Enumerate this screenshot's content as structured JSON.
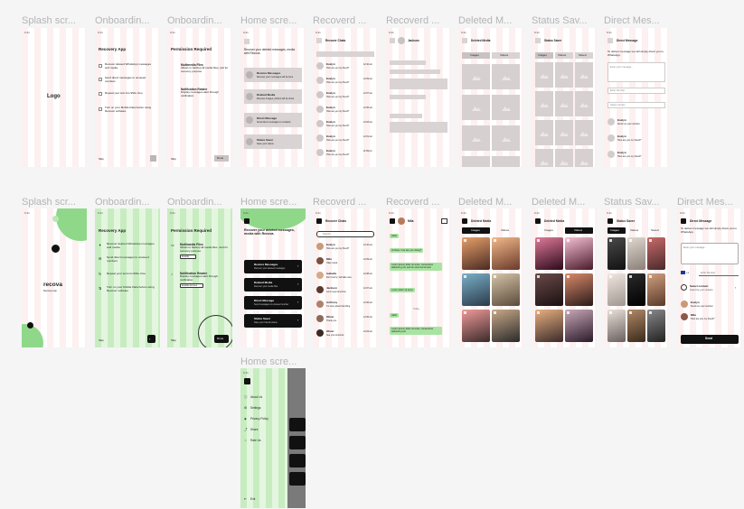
{
  "labels_row1": [
    "Splash scr...",
    "Onboardin...",
    "Onboardin...",
    "Home scre...",
    "Recoverd ...",
    "Recoverd ...",
    "Deleted M...",
    "Status Sav...",
    "Direct Mes..."
  ],
  "labels_row2": [
    "Splash scr...",
    "Onboardin...",
    "Onboardin...",
    "Home scre...",
    "Recoverd ...",
    "Recoverd ...",
    "Deleted M...",
    "Deleted M...",
    "Status Sav...",
    "Direct Mes..."
  ],
  "label_row3": "Home scre...",
  "status_bar": "9:41",
  "wf": {
    "logo": "Logo",
    "onb1_title": "Recovery App",
    "onb1_items": [
      "Recover deleted WhatsApp messages and media",
      "Send direct messages to unsaved numbers",
      "Repeat your text into 999+ time",
      "Turn on your Mobile Data before using Recover software"
    ],
    "skip": "Skip",
    "onb2_title": "Permission Required",
    "onb2_items": [
      {
        "title": "Multimedia Files",
        "desc": "Allows to backup all media files, just for recovery purpose"
      },
      {
        "title": "Notification Reader",
        "desc": "Display messages alert through notification"
      }
    ],
    "done": "Done",
    "home_intro": "Recover your deleted messages, media with Recova.",
    "home_items": [
      {
        "title": "Restore Messages",
        "desc": "Recover your messages will be here"
      },
      {
        "title": "Deleted Media",
        "desc": "Recover images, photos will be show"
      },
      {
        "title": "Direct Message",
        "desc": "Send direct messages to contacts"
      },
      {
        "title": "Status Saver",
        "desc": "Save your status"
      }
    ],
    "chats_title": "Recover Chats",
    "chats": [
      {
        "name": "Evelyn",
        "msg": "How are you my friend?",
        "time": "12:10 am"
      },
      {
        "name": "Evelyn",
        "msg": "How are you my friend?",
        "time": "12:09 am"
      },
      {
        "name": "Evelyn",
        "msg": "How are you my friend?",
        "time": "12:07 am"
      },
      {
        "name": "Evelyn",
        "msg": "How are you my friend?",
        "time": "12:05 am"
      },
      {
        "name": "Evelyn",
        "msg": "How are you my friend?",
        "time": "12:03 am"
      },
      {
        "name": "Evelyn",
        "msg": "How are you my friend?",
        "time": "12:01 am"
      },
      {
        "name": "Evelyn",
        "msg": "How are you my friend?",
        "time": "11:59 pm"
      }
    ],
    "conv_name": "Jackson",
    "dm_title": "Deleted Media",
    "tab_images": "Images",
    "tab_videos": "Videos",
    "status_title": "Status Saver",
    "tab_saved": "Saved",
    "direct_title": "Direct Message",
    "direct_intro": "To deliver message we will simply direct you to WhatsApp.",
    "direct_fields": [
      "Enter your message...",
      "Enter Number",
      "Select contact"
    ],
    "direct_contacts": [
      {
        "name": "Evelyn",
        "msg": "Send me your number"
      },
      {
        "name": "Evelyn",
        "msg": "How are you my friend?"
      },
      {
        "name": "Evelyn",
        "msg": "How are you my friend?"
      }
    ]
  },
  "hifi": {
    "brand": "recova",
    "brand_sub": "Recovery App",
    "onb1_title": "Recovery App",
    "onb1_items": [
      "Recover deleted WhatsApp messages and media",
      "Send direct messages to unsaved numbers",
      "Repeat your text into 999+ time",
      "Turn on your Mobile Data before using Recover software"
    ],
    "skip": "Skip",
    "onb2_title": "Permission Required",
    "onb2_items": [
      {
        "title": "Multimedia Files",
        "desc": "Allows to backup all media files, Just for recovery purpose",
        "button": "Enable"
      },
      {
        "title": "Notification Reader",
        "desc": "Display messages alert through notification",
        "button": "Enable Access"
      }
    ],
    "done": "Done",
    "home_intro": "Recover your deleted messages, media with Recova.",
    "home_items": [
      {
        "title": "Restore Messages",
        "desc": "Recover your deleted messages"
      },
      {
        "title": "Deleted Media",
        "desc": "Recover your media files"
      },
      {
        "title": "Direct Message",
        "desc": "Send messages to unsaved number"
      },
      {
        "title": "Status Saver",
        "desc": "Save your friends status"
      }
    ],
    "chats_title": "Recover Chats",
    "search_placeholder": "Search",
    "chats": [
      {
        "name": "Evelyn",
        "msg": "How are you my friend?",
        "time": "12:10 am"
      },
      {
        "name": "Mila",
        "msg": "Okay noted",
        "time": "12:09 am"
      },
      {
        "name": "Isabella",
        "msg": "Don't worry I will take care",
        "time": "12:08 am"
      },
      {
        "name": "Jackson",
        "msg": "Let's meet tomorrow",
        "time": "12:07 am"
      },
      {
        "name": "Anthony",
        "msg": "I'm sorry about that thing",
        "time": "12:06 am"
      },
      {
        "name": "Oliver",
        "msg": "Thank you",
        "time": "12:05 am"
      },
      {
        "name": "Oliver",
        "msg": "See you tomorrow",
        "time": "12:04 am"
      }
    ],
    "conv_name": "Mila",
    "conv_messages": [
      {
        "from": "in",
        "text": "Hello"
      },
      {
        "from": "in",
        "text": "Hi there, how are you doing?"
      },
      {
        "from": "out",
        "text": "Lorem ipsum dolor sit amet, consectetur adipiscing elit, sed do eiusmod tempor"
      },
      {
        "from": "in",
        "text": "Lorem dolor sit amet"
      },
      {
        "from": "in",
        "text": "Hello"
      },
      {
        "from": "in",
        "text": "Lorem ipsum dolor sit amet, consectetur adipiscing elit"
      }
    ],
    "conv_day": "Today",
    "dm_title": "Deleted Media",
    "tab_images": "Images",
    "tab_videos": "Videos",
    "status_title": "Status Saver",
    "tab_saved": "Saved",
    "direct_title": "Direct Message",
    "direct_intro": "To deliver message we will simply direct you to WhatsApp.",
    "direct_message_placeholder": "Enter your message...",
    "direct_country": "+1",
    "direct_number_placeholder": "Enter Number",
    "direct_select": "Select contact",
    "direct_select_desc": "Select the your contacts",
    "direct_contacts": [
      {
        "name": "Evelyn",
        "msg": "Send me your number"
      },
      {
        "name": "Mila",
        "msg": "How are you my friend?"
      }
    ],
    "send": "Send",
    "menu_items": [
      "About Us",
      "Settings",
      "Privacy Policy",
      "Share",
      "Rate Us"
    ],
    "exit": "Exit"
  },
  "colors": {
    "canvas": "#f5f5f5",
    "wire_stripe": "#fdf0f0",
    "green_stripe": "#c7ecc0",
    "green_accent": "#8fd88a",
    "dark": "#111111",
    "placeholder": "#d9d3d3"
  }
}
